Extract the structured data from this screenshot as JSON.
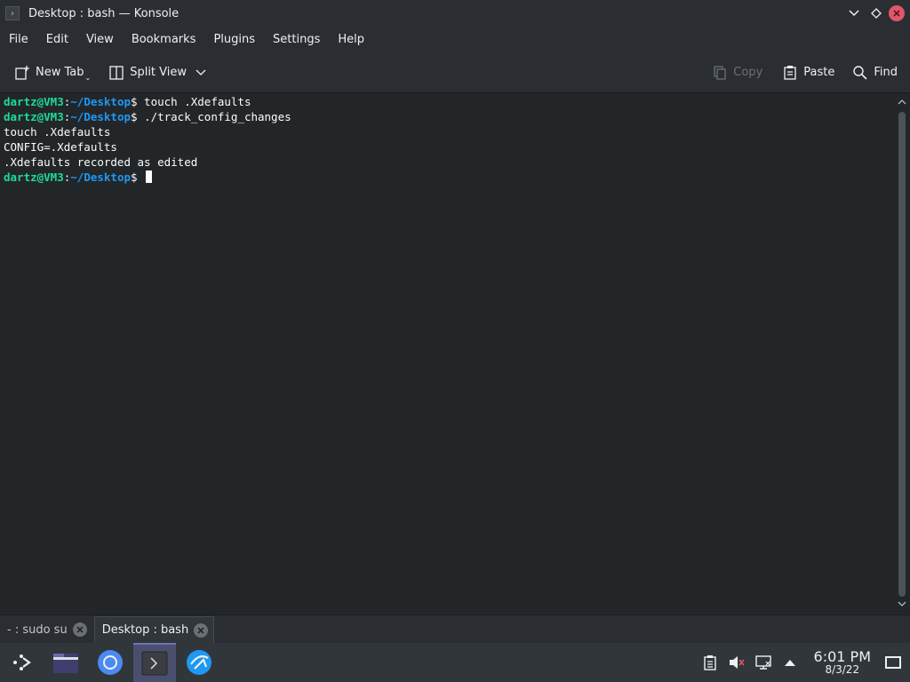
{
  "window": {
    "title": "Desktop : bash — Konsole"
  },
  "menubar": {
    "items": [
      "File",
      "Edit",
      "View",
      "Bookmarks",
      "Plugins",
      "Settings",
      "Help"
    ]
  },
  "toolbar": {
    "new_tab": "New Tab",
    "split_view": "Split View",
    "copy": "Copy",
    "paste": "Paste",
    "find": "Find"
  },
  "terminal": {
    "lines": [
      {
        "type": "prompt",
        "user": "dartz@VM3",
        "path": "~/Desktop",
        "cmd": " touch .Xdefaults"
      },
      {
        "type": "prompt",
        "user": "dartz@VM3",
        "path": "~/Desktop",
        "cmd": " ./track_config_changes"
      },
      {
        "type": "output",
        "text": "touch .Xdefaults"
      },
      {
        "type": "output",
        "text": "CONFIG=.Xdefaults"
      },
      {
        "type": "output",
        "text": ".Xdefaults recorded as edited"
      },
      {
        "type": "prompt",
        "user": "dartz@VM3",
        "path": "~/Desktop",
        "cmd": " ",
        "cursor": true
      }
    ]
  },
  "tabs": [
    {
      "label": "- : sudo su",
      "active": false
    },
    {
      "label": "Desktop : bash",
      "active": true
    }
  ],
  "taskbar": {
    "apps": [
      "app-launcher-icon",
      "file-manager-icon",
      "chromium-icon",
      "konsole-icon",
      "discover-icon"
    ],
    "active_app": "konsole-icon"
  },
  "clock": {
    "time": "6:01 PM",
    "date": "8/3/22"
  },
  "tray": {
    "icons": [
      "clipboard-icon",
      "volume-muted-icon",
      "network-icon",
      "tray-expand-icon"
    ]
  },
  "colors": {
    "user": "#1cdc9a",
    "path": "#1d99f3",
    "bg": "#232629"
  }
}
